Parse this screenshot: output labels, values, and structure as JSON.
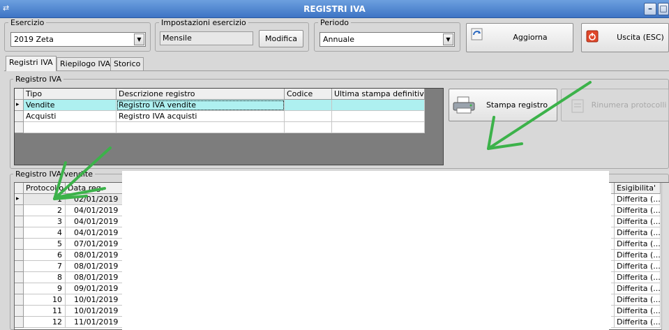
{
  "window": {
    "title": "REGISTRI IVA"
  },
  "esercizio": {
    "label": "Esercizio",
    "value": "2019 Zeta"
  },
  "impostazioni": {
    "label": "Impostazioni esercizio",
    "value": "Mensile",
    "modifica_label": "Modifica"
  },
  "periodo": {
    "label": "Periodo",
    "value": "Annuale"
  },
  "toolbar": {
    "aggiorna_label": "Aggiorna",
    "uscita_label": "Uscita (ESC)"
  },
  "tabs": [
    {
      "label": "Registri IVA"
    },
    {
      "label": "Riepilogo IVA"
    },
    {
      "label": "Storico"
    }
  ],
  "registro_group": {
    "label": "Registro IVA"
  },
  "registro_table": {
    "columns": [
      "Tipo",
      "Descrizione registro",
      "Codice",
      "Ultima stampa definitiva"
    ],
    "rows": [
      {
        "tipo": "Vendite",
        "descrizione": "Registro IVA vendite",
        "codice": "",
        "ultima": ""
      },
      {
        "tipo": "Acquisti",
        "descrizione": "Registro IVA acquisti",
        "codice": "",
        "ultima": ""
      }
    ]
  },
  "actions": {
    "stampa_label": "Stampa registro",
    "rinumera_label": "Rinumera protocolli"
  },
  "vendite_group": {
    "label": "Registro IVA vendite"
  },
  "vendite_table": {
    "columns": {
      "protocollo": "Protocollo",
      "data_reg": "Data reg.",
      "esigibilita": "Esigibilita'"
    },
    "rows": [
      {
        "protocollo": "1",
        "data": "02/01/2019",
        "esig": "Differita (..."
      },
      {
        "protocollo": "2",
        "data": "04/01/2019",
        "esig": "Differita (..."
      },
      {
        "protocollo": "3",
        "data": "04/01/2019",
        "esig": "Differita (..."
      },
      {
        "protocollo": "4",
        "data": "04/01/2019",
        "esig": "Differita (..."
      },
      {
        "protocollo": "5",
        "data": "07/01/2019",
        "esig": "Differita (..."
      },
      {
        "protocollo": "6",
        "data": "08/01/2019",
        "esig": "Differita (..."
      },
      {
        "protocollo": "7",
        "data": "08/01/2019",
        "esig": "Differita (..."
      },
      {
        "protocollo": "8",
        "data": "08/01/2019",
        "esig": "Differita (..."
      },
      {
        "protocollo": "9",
        "data": "09/01/2019",
        "esig": "Differita (..."
      },
      {
        "protocollo": "10",
        "data": "10/01/2019",
        "esig": "Differita (..."
      },
      {
        "protocollo": "11",
        "data": "10/01/2019",
        "esig": "Differita (..."
      },
      {
        "protocollo": "12",
        "data": "11/01/2019",
        "esig": "Differita (..."
      }
    ]
  },
  "colors": {
    "selection": "#aef0f0",
    "annotation_arrow": "#3cb24a",
    "titlebar": "#4a80cc"
  },
  "icons": {
    "app": "app-icon",
    "aggiorna": "refresh-icon",
    "uscita": "exit-icon",
    "stampa": "printer-icon",
    "rinumera": "renumber-icon"
  }
}
